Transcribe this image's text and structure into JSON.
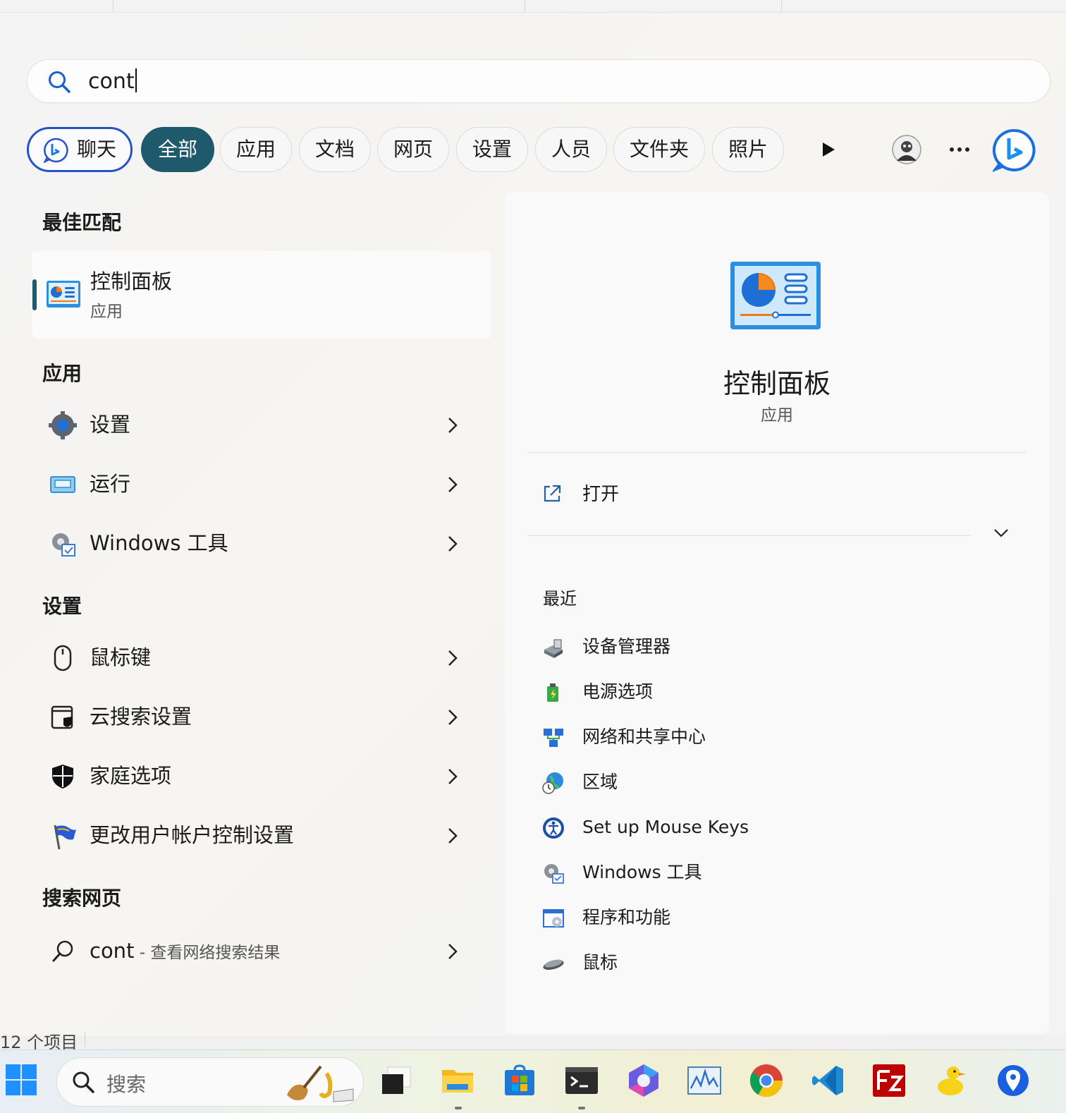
{
  "search": {
    "query": "cont"
  },
  "filters": [
    {
      "label": "聊天"
    },
    {
      "label": "全部"
    },
    {
      "label": "应用"
    },
    {
      "label": "文档"
    },
    {
      "label": "网页"
    },
    {
      "label": "设置"
    },
    {
      "label": "人员"
    },
    {
      "label": "文件夹"
    },
    {
      "label": "照片"
    }
  ],
  "sections": {
    "best_match": "最佳匹配",
    "apps": "应用",
    "settings": "设置",
    "web": "搜索网页"
  },
  "best_match": {
    "name": "控制面板",
    "type": "应用"
  },
  "apps": [
    {
      "label": "设置",
      "icon": "gear-icon"
    },
    {
      "label": "运行",
      "icon": "run-icon"
    },
    {
      "label": "Windows 工具",
      "icon": "windows-tools-icon"
    }
  ],
  "settings": [
    {
      "label": "鼠标键",
      "icon": "mouse-icon"
    },
    {
      "label": "云搜索设置",
      "icon": "cloud-search-icon"
    },
    {
      "label": "家庭选项",
      "icon": "shield-icon"
    },
    {
      "label": "更改用户帐户控制设置",
      "icon": "uac-flag-icon"
    }
  ],
  "web": {
    "query": "cont",
    "suffix": " - 查看网络搜索结果"
  },
  "detail": {
    "title": "控制面板",
    "type": "应用",
    "open_label": "打开",
    "recent_title": "最近",
    "recent": [
      {
        "label": "设备管理器",
        "icon": "device-manager-icon"
      },
      {
        "label": "电源选项",
        "icon": "power-options-icon"
      },
      {
        "label": "网络和共享中心",
        "icon": "network-icon"
      },
      {
        "label": "区域",
        "icon": "region-globe-icon"
      },
      {
        "label": "Set up Mouse Keys",
        "icon": "ease-of-access-icon"
      },
      {
        "label": "Windows 工具",
        "icon": "windows-tools-icon"
      },
      {
        "label": "程序和功能",
        "icon": "programs-icon"
      },
      {
        "label": "鼠标",
        "icon": "mouse-icon"
      }
    ]
  },
  "background": {
    "status_text": "12 个项目"
  },
  "taskbar": {
    "search_placeholder": "搜索",
    "apps": [
      "start-icon",
      "task-view-icon",
      "file-explorer-icon",
      "store-icon",
      "terminal-icon",
      "copilot-icon",
      "resource-monitor-icon",
      "chrome-icon",
      "vscode-icon",
      "filezilla-icon",
      "duck-icon",
      "maps-icon"
    ]
  },
  "colors": {
    "accent": "#1f5a6c",
    "chat_border": "#2553c8"
  }
}
